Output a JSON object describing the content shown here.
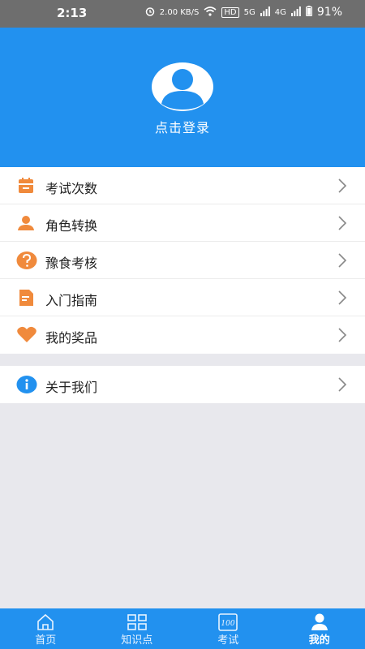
{
  "status_bar": {
    "time": "2:13",
    "net_speed": "2.00 KB/S",
    "hd": "HD",
    "sig1": "5G",
    "sig2": "4G",
    "battery": "91%"
  },
  "header": {
    "login_label": "点击登录",
    "bg_color": "#2291ef"
  },
  "menu": {
    "items": [
      {
        "label": "考试次数",
        "icon": "calendar-icon",
        "color": "#f08a3c"
      },
      {
        "label": "角色转换",
        "icon": "user-icon",
        "color": "#f08a3c"
      },
      {
        "label": "豫食考核",
        "icon": "question-icon",
        "color": "#f08a3c"
      },
      {
        "label": "入门指南",
        "icon": "document-icon",
        "color": "#f08a3c"
      },
      {
        "label": "我的奖品",
        "icon": "heart-icon",
        "color": "#f08a3c"
      }
    ],
    "about": {
      "label": "关于我们",
      "icon": "info-icon",
      "color": "#2291ef"
    }
  },
  "tabs": [
    {
      "label": "首页",
      "icon": "home-icon"
    },
    {
      "label": "知识点",
      "icon": "grid-icon"
    },
    {
      "label": "考试",
      "icon": "exam-icon"
    },
    {
      "label": "我的",
      "icon": "profile-icon",
      "active": true
    }
  ]
}
